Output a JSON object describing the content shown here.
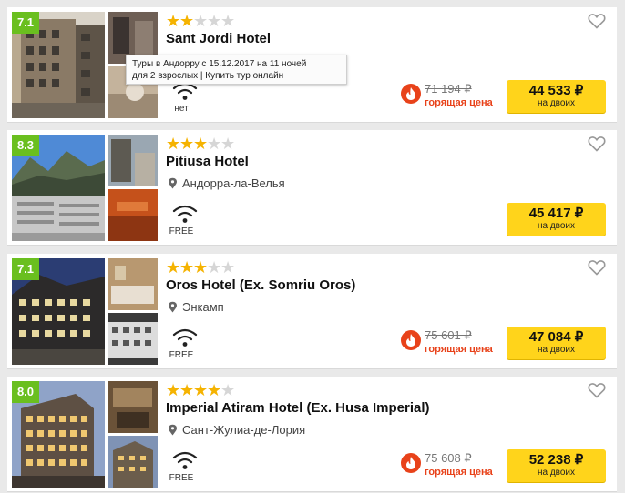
{
  "tooltip": {
    "line1": "Туры в Андорру с 15.12.2017 на 11 ночей",
    "line2": "для 2 взрослых | Купить тур онлайн"
  },
  "hotels": [
    {
      "rating": "7.1",
      "stars": 2,
      "name": "Sant Jordi Hotel",
      "location": "",
      "wifi": "нет",
      "old_price": "71 194 ₽",
      "hot_label": "горящая цена",
      "price": "44 533 ₽",
      "price_sub": "на двоих"
    },
    {
      "rating": "8.3",
      "stars": 3,
      "name": "Pitiusa Hotel",
      "location": "Андорра-ла-Велья",
      "wifi": "FREE",
      "old_price": "",
      "hot_label": "",
      "price": "45 417 ₽",
      "price_sub": "на двоих"
    },
    {
      "rating": "7.1",
      "stars": 3,
      "name": "Oros Hotel (Ex. Somriu Oros)",
      "location": "Энкамп",
      "wifi": "FREE",
      "old_price": "75 601 ₽",
      "hot_label": "горящая цена",
      "price": "47 084 ₽",
      "price_sub": "на двоих"
    },
    {
      "rating": "8.0",
      "stars": 4,
      "name": "Imperial Atiram Hotel (Ex. Husa Imperial)",
      "location": "Сант-Жулиа-де-Лория",
      "wifi": "FREE",
      "old_price": "75 608 ₽",
      "hot_label": "горящая цена",
      "price": "52 238 ₽",
      "price_sub": "на двоих"
    }
  ],
  "colors": {
    "rating_badge": "#6abf1f",
    "star_on": "#f5b301",
    "star_off": "#d6d6d6",
    "price_button": "#ffd41b",
    "hot_price": "#e8421a"
  }
}
